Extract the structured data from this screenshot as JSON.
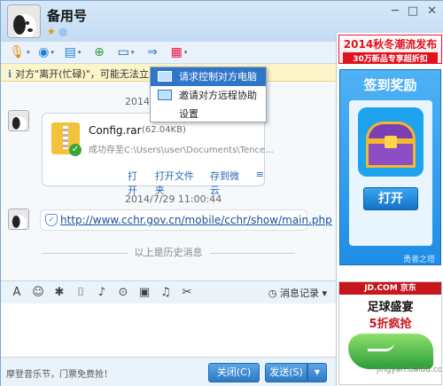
{
  "contact": {
    "name": "备用号"
  },
  "window_controls": {
    "min": "─",
    "max": "□",
    "close": "✕"
  },
  "toolbar": {
    "items": [
      "microphone-icon",
      "video-icon",
      "file-transfer-icon",
      "add-app-icon",
      "remote-desktop-icon",
      "share-screen-icon",
      "apps-icon"
    ]
  },
  "notice": "对方\"离开(忙碌)\"，可能无法立即",
  "chat": {
    "ts1": "2014/",
    "file": {
      "name": "Config.rar",
      "size": "(62.04KB)",
      "path": "成功存至C:\\Users\\user\\Documents\\Tence...",
      "actions": [
        "打开",
        "打开文件夹",
        "存到微云"
      ]
    },
    "ts2": "2014/7/29 11:00:44",
    "link": "http://www.cchr.gov.cn/mobile/cchr/show/main.php",
    "history_divider": "以上是历史消息"
  },
  "menu": {
    "items": [
      "请求控制对方电脑",
      "邀请对方远程协助",
      "设置"
    ]
  },
  "input_toolbar": {
    "history_label": "消息记录"
  },
  "bottom": {
    "ad_text": "摩登音乐节，门票免费抢！",
    "close": "关闭(C)",
    "send": "发送(S)"
  },
  "ads": {
    "top_line1": "2014秋冬潮流发布",
    "top_line2": "30万新品专享超折扣",
    "sign_title": "签到奖励",
    "open": "打开",
    "sign_footer": "勇者之塔",
    "jd": "JD.COM 京东",
    "ad2_line1": "足球盛宴",
    "ad2_line2": "5折疯抢",
    "watermark": "jingyan.baidu.com"
  },
  "colors": {
    "accent": "#2f76c9",
    "ad_red": "#e1121e"
  }
}
